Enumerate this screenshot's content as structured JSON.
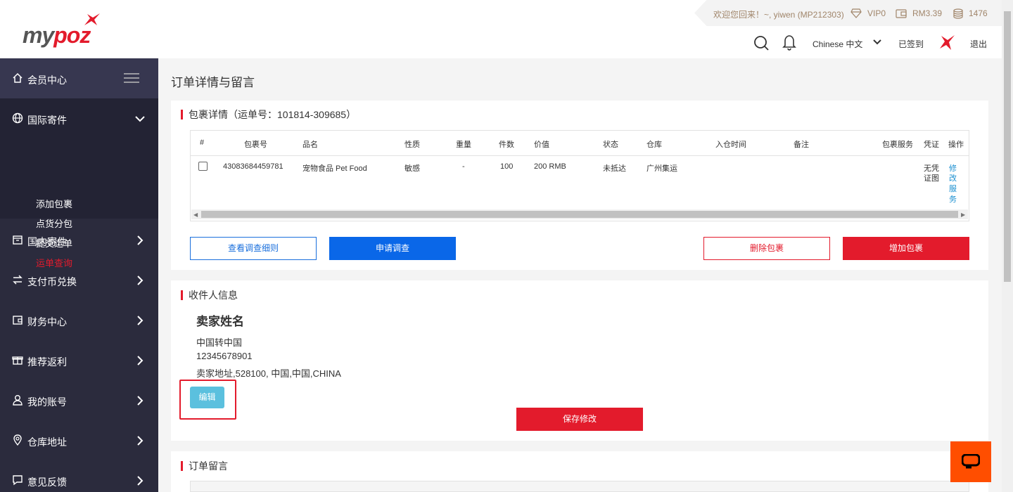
{
  "header": {
    "logo": "mypoz",
    "welcome": "欢迎您回来！~, yiwen (MP212303)",
    "vip": "VIP0",
    "balance": "RM3.39",
    "points": "1476",
    "language": "Chinese  中文",
    "signed_in": "已签到",
    "logout": "退出"
  },
  "sidebar": {
    "member_center": "会员中心",
    "items": [
      {
        "label": "国际寄件",
        "icon": "globe-icon"
      },
      {
        "label": "国内寄件",
        "icon": "box-icon"
      },
      {
        "label": "支付币兑换",
        "icon": "exchange-icon"
      },
      {
        "label": "财务中心",
        "icon": "wallet-icon"
      },
      {
        "label": "推荐返利",
        "icon": "gift-icon"
      },
      {
        "label": "我的账号",
        "icon": "user-icon"
      },
      {
        "label": "仓库地址",
        "icon": "location-icon"
      },
      {
        "label": "意见反馈",
        "icon": "feedback-icon"
      }
    ],
    "sub_items": [
      "添加包裹",
      "点货分包",
      "提交运单",
      "运单查询"
    ]
  },
  "page": {
    "title": "订单详情与留言"
  },
  "package": {
    "title": "包裹详情（运单号：101814-309685）",
    "columns": [
      "#",
      "包裹号",
      "品名",
      "性质",
      "重量",
      "件数",
      "价值",
      "状态",
      "仓库",
      "入仓时间",
      "备注",
      "包裹服务",
      "凭证",
      "操作"
    ],
    "row": {
      "package_no": "43083684459781",
      "name": "宠物食品 Pet Food",
      "nature": "敏感",
      "weight": "-",
      "count": "100",
      "value": "200 RMB",
      "status": "未抵达",
      "warehouse": "广州集运",
      "voucher": [
        "无凭",
        "证图"
      ],
      "action": [
        "修",
        "改",
        "服",
        "务"
      ]
    },
    "buttons": {
      "view_rules": "查看调查细则",
      "apply_survey": "申请调查",
      "delete": "删除包裹",
      "add": "增加包裹"
    }
  },
  "receiver": {
    "title": "收件人信息",
    "name": "卖家姓名",
    "country": "中国转中国",
    "phone": "12345678901",
    "address": "卖家地址,528100, 中国,中国,CHINA",
    "edit": "编辑",
    "save": "保存修改"
  },
  "message": {
    "title": "订单留言"
  }
}
